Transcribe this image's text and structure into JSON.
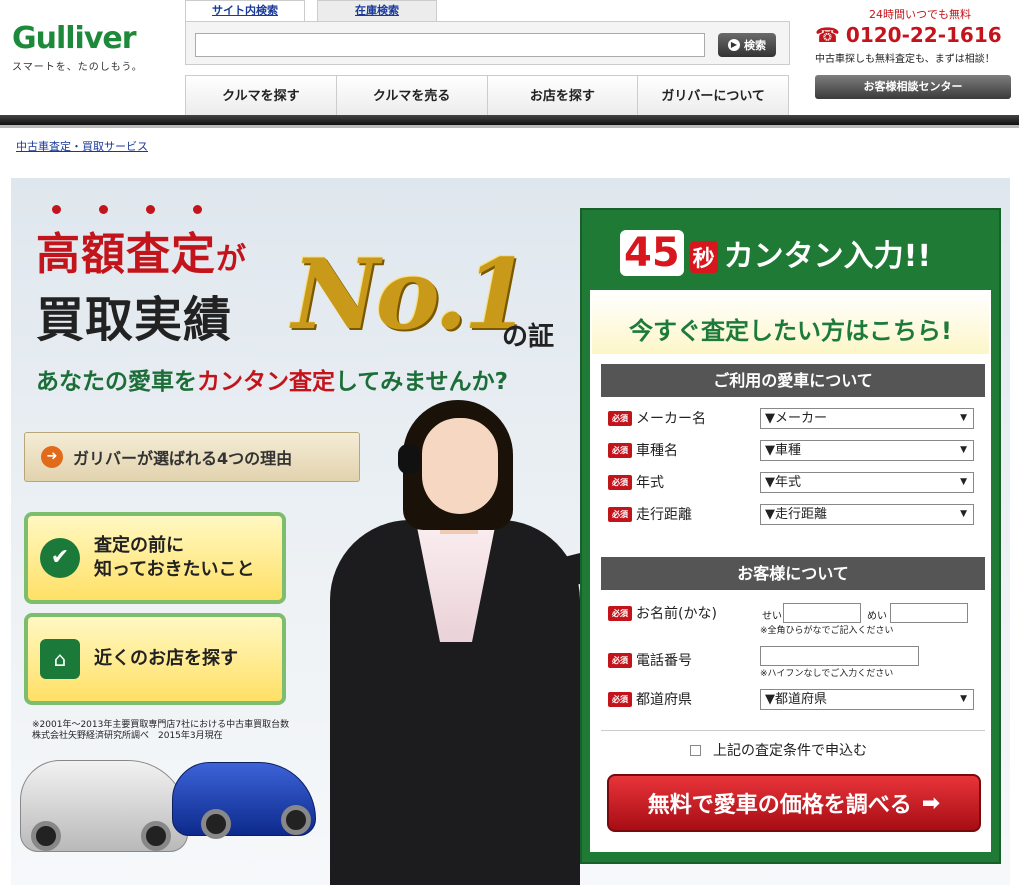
{
  "header": {
    "logo_text": "Gulliver",
    "logo_tagline": "スマートを、たのしもう。",
    "search_tabs": [
      "サイト内検索",
      "在庫検索"
    ],
    "search_button": "検索",
    "nav": [
      "クルマを探す",
      "クルマを売る",
      "お店を探す",
      "ガリバーについて"
    ],
    "phone_hours": "24時間いつでも無料",
    "phone_number": "0120-22-1616",
    "phone_note": "中古車探しも無料査定も、まずは相談！",
    "consult_button": "お客様相談センター"
  },
  "breadcrumb": "中古車査定・買取サービス",
  "hero": {
    "line1_a": "高額査定",
    "line1_b": "が",
    "line2": "買取実績",
    "no1": "No.1",
    "no1_suffix": "の証",
    "line3_a": "あなたの愛車を",
    "line3_b": "カンタン査定",
    "line3_c": "してみませんか?",
    "reason_button": "ガリバーが選ばれる4つの理由",
    "box1_line1": "査定の前に",
    "box1_line2": "知っておきたいこと",
    "box2": "近くのお店を探す",
    "footnote_1": "※2001年〜2013年主要買取専門店7社における中古車買取台数",
    "footnote_2": "株式会社矢野経済研究所調べ　2015年3月現在"
  },
  "form": {
    "title_num": "45",
    "title_sec": "秒",
    "title_rest": "カンタン入力!!",
    "lead": "今すぐ査定したい方はこちら!",
    "section1": "ご利用の愛車について",
    "required": "必須",
    "maker_label": "メーカー名",
    "maker_value": "▼メーカー",
    "model_label": "車種名",
    "model_value": "▼車種",
    "year_label": "年式",
    "year_value": "▼年式",
    "mileage_label": "走行距離",
    "mileage_value": "▼走行距離",
    "section2": "お客様について",
    "name_label": "お名前(かな)",
    "sei": "せい",
    "mei": "めい",
    "name_note": "※全角ひらがなでご記入ください",
    "phone_label": "電話番号",
    "phone_note": "※ハイフンなしでご入力ください",
    "pref_label": "都道府県",
    "pref_value": "▼都道府県",
    "agree": "上記の査定条件で申込む",
    "submit": "無料で愛車の価格を調べる"
  },
  "colors": {
    "brand_green": "#1f7a36",
    "accent_red": "#c4141b"
  }
}
